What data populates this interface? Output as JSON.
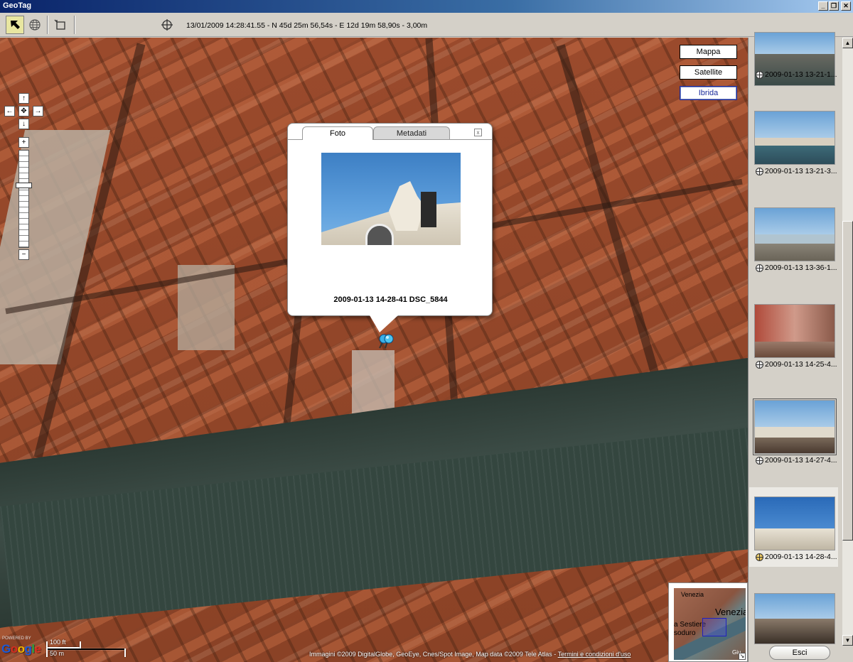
{
  "window": {
    "title": "GeoTag",
    "controls": [
      "_",
      "❐",
      "✕"
    ]
  },
  "toolbar": {
    "status": "13/01/2009 14:28:41.55 - N 45d 25m 56,54s - E 12d 19m 58,90s - 3,00m"
  },
  "map": {
    "types": {
      "map": "Mappa",
      "satellite": "Satellite",
      "hybrid": "Ibrida"
    },
    "selected_type": "Ibrida",
    "nav": {
      "up": "↑",
      "left": "←",
      "center": "✥",
      "right": "→",
      "down": "↓",
      "zoom_in": "+",
      "zoom_out": "−"
    },
    "zoom_level": 0.65,
    "popup": {
      "tab_photo": "Foto",
      "tab_metadata": "Metadati",
      "close": "x",
      "caption": "2009-01-13 14-28-41 DSC_5844"
    },
    "logo": {
      "powered": "POWERED BY",
      "g1": "G",
      "o1": "o",
      "o2": "o",
      "g2": "g",
      "l": "l",
      "e": "e"
    },
    "scale": {
      "imperial": "100 ft",
      "metric": "50 m"
    },
    "copyright": "Immagini ©2009 DigitalGlobe, GeoEye, Cnes/Spot Image, Map data ©2009 Tele Atlas - ",
    "terms_link": "Termini e condizioni d'uso",
    "overview": {
      "label1": "Venezia",
      "label2": "Venezia",
      "label3": "a Sestiere",
      "label4": "soduro",
      "label5": "Giu"
    }
  },
  "thumbnails": [
    {
      "label": "2009-01-13 13-21-1...",
      "selected": false
    },
    {
      "label": "2009-01-13 13-21-3...",
      "selected": false
    },
    {
      "label": "2009-01-13 13-36-1...",
      "selected": false
    },
    {
      "label": "2009-01-13 14-25-4...",
      "selected": false
    },
    {
      "label": "2009-01-13 14-27-4...",
      "selected": false
    },
    {
      "label": "2009-01-13 14-28-4...",
      "selected": true
    },
    {
      "label": "",
      "selected": false
    }
  ],
  "footer": {
    "exit_label": "Esci"
  },
  "colors": {
    "title_bar": "#0a246a",
    "selected_type": "#1a2a9a",
    "water": "#34463f",
    "roofs": "#9a4a2c"
  }
}
